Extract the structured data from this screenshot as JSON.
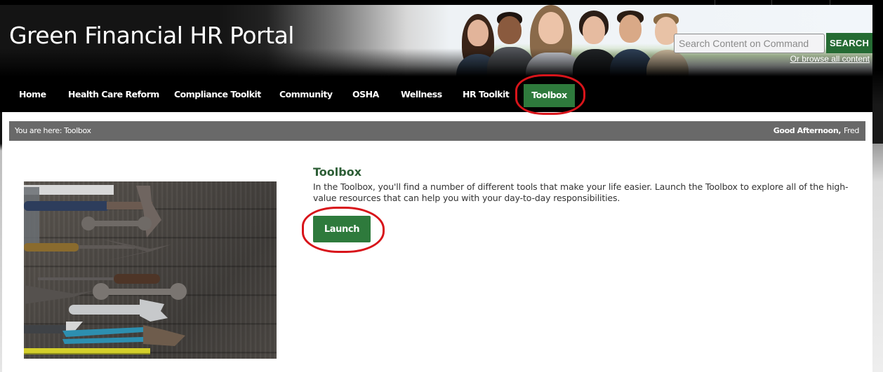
{
  "header": {
    "site_title": "Green Financial HR Portal",
    "search": {
      "placeholder": "Search Content on Command",
      "value": "",
      "button_label": "SEARCH",
      "browse_link": "Or browse all content"
    }
  },
  "nav": {
    "items": [
      {
        "label": "Home",
        "active": false
      },
      {
        "label": "Health Care Reform",
        "active": false
      },
      {
        "label": "Compliance Toolkit",
        "active": false
      },
      {
        "label": "Community",
        "active": false
      },
      {
        "label": "OSHA",
        "active": false
      },
      {
        "label": "Wellness",
        "active": false
      },
      {
        "label": "HR Toolkit",
        "active": false
      },
      {
        "label": "Toolbox",
        "active": true
      }
    ]
  },
  "breadcrumb": {
    "text": "You are here: Toolbox",
    "greeting_label": "Good Afternoon,",
    "user_name": "Fred"
  },
  "main": {
    "image_alt": "Assorted hand tools on a dark wooden surface",
    "title": "Toolbox",
    "description": "In the Toolbox, you'll find a number of different tools that make your life easier. Launch the Toolbox to explore all of the high-value resources that can help you with your day-to-day responsibilities.",
    "launch_label": "Launch"
  },
  "annotations": {
    "circled_elements": [
      "nav-item-toolbox",
      "launch-button"
    ],
    "color": "#d8141a"
  },
  "colors": {
    "brand_green": "#2e7a3c",
    "search_green": "#256b33",
    "title_green": "#2d5e36",
    "breadcrumb_gray": "#696969"
  }
}
